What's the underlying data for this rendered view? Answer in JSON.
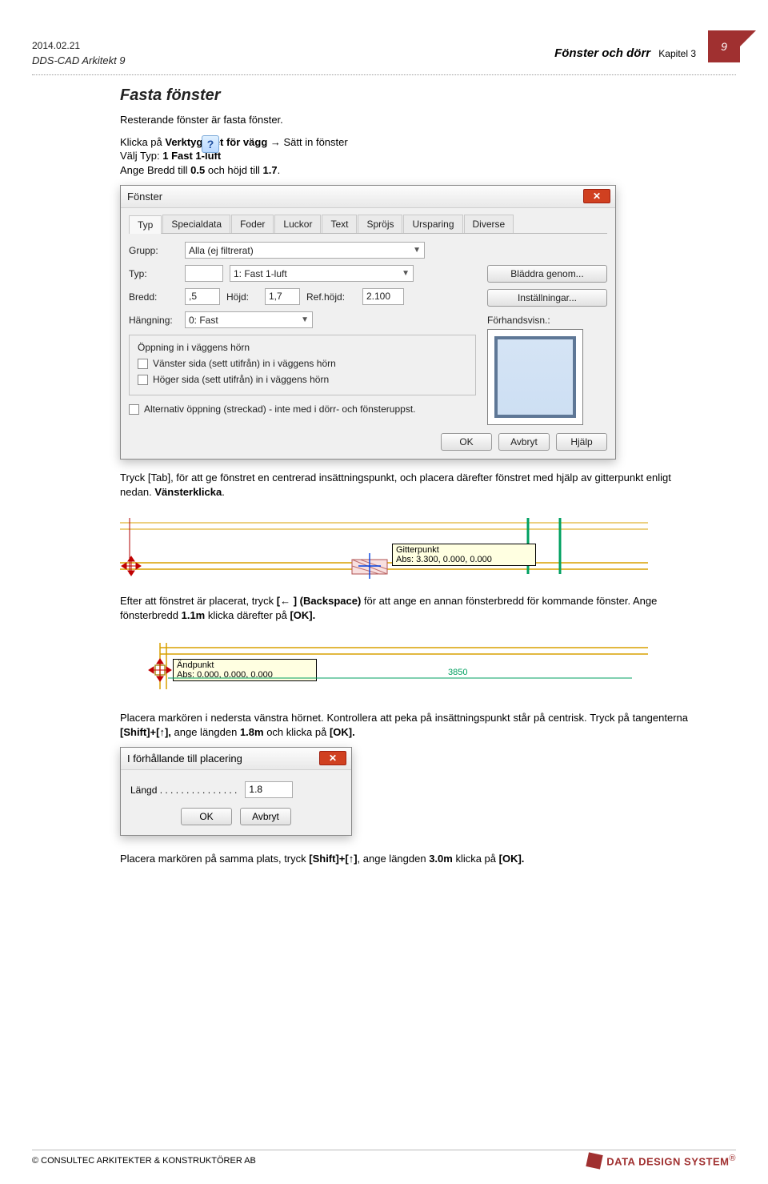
{
  "header": {
    "date": "2014.02.21",
    "software": "DDS-CAD Arkitekt 9",
    "doc_title": "Fönster och dörr",
    "chapter": "Kapitel 3",
    "page_number": "9"
  },
  "heading": "Fasta fönster",
  "text": {
    "intro": "Resterande fönster är fasta fönster.",
    "p2_a": "Klicka på ",
    "p2_b": "Verktygsset för vägg",
    "p2_c": " → Sätt in fönster",
    "p3_a": "Välj Typ: ",
    "p3_b": "1 Fast 1-luft",
    "p4_a": "Ange Bredd till ",
    "p4_b": "0.5",
    "p4_c": " och höjd till ",
    "p4_d": "1.7",
    "p4_e": ".",
    "p5_a": "Tryck [Tab], för att ge fönstret en centrerad insättningspunkt, och placera därefter fönstret med hjälp av gitterpunkt enligt nedan. ",
    "p5_b": "Vänsterklicka",
    "p5_c": ".",
    "p6_a": "Efter att fönstret är placerat, tryck ",
    "p6_b": "[← ] (Backspace)",
    "p6_c": " för att ange en annan fönsterbredd för kommande fönster. Ange fönsterbredd ",
    "p6_d": "1.1m",
    "p6_e": " klicka därefter på ",
    "p6_f": "[OK].",
    "p7_a": "Placera markören i nedersta vänstra hörnet. Kontrollera att peka på insättningspunkt står på centrisk. Tryck på tangenterna ",
    "p7_b": "[Shift]+[↑],",
    "p7_c": " ange längden ",
    "p7_d": "1.8m",
    "p7_e": " och klicka på ",
    "p7_f": "[OK].",
    "p8_a": "Placera markören på samma plats, tryck ",
    "p8_b": "[Shift]+[↑]",
    "p8_c": ", ange längden ",
    "p8_d": "3.0m",
    "p8_e": " klicka på ",
    "p8_f": "[OK]."
  },
  "dialog1": {
    "title": "Fönster",
    "tabs": [
      "Typ",
      "Specialdata",
      "Foder",
      "Luckor",
      "Text",
      "Spröjs",
      "Ursparing",
      "Diverse"
    ],
    "lbl_grupp": "Grupp:",
    "grupp_value": "Alla (ej filtrerat)",
    "lbl_typ": "Typ:",
    "typ_value": "1: Fast 1-luft",
    "btn_bladdra": "Bläddra genom...",
    "lbl_bredd": "Bredd:",
    "bredd_value": ",5",
    "lbl_hojd": "Höjd:",
    "hojd_value": "1,7",
    "lbl_refhojd": "Ref.höjd:",
    "refhojd_value": "2.100",
    "btn_installningar": "Inställningar...",
    "lbl_hangning": "Hängning:",
    "hangning_value": "0: Fast",
    "lbl_forhand": "Förhandsvisn.:",
    "group_label": "Öppning in i väggens hörn",
    "chk1": "Vänster sida (sett utifrån) in i väggens hörn",
    "chk2": "Höger sida (sett utifrån) in i väggens hörn",
    "chk3": "Alternativ öppning (streckad) - inte med i dörr- och fönsteruppst.",
    "btn_ok": "OK",
    "btn_avbryt": "Avbryt",
    "btn_hjalp": "Hjälp"
  },
  "drawing1": {
    "tooltip_title": "Gitterpunkt",
    "tooltip_coords": "Abs: 3.300, 0.000, 0.000"
  },
  "drawing2": {
    "tooltip_title": "Ändpunkt",
    "tooltip_coords": "Abs: 0.000, 0.000, 0.000",
    "dim": "3850"
  },
  "dialog2": {
    "title": "I förhållande till  placering",
    "lbl_langd": "Längd . . . . . . . . . . . . . . .",
    "langd_value": "1.8",
    "btn_ok": "OK",
    "btn_avbryt": "Avbryt"
  },
  "footer": {
    "left": "© CONSULTEC ARKITEKTER & KONSTRUKTÖRER AB",
    "brand_a": "DATA ",
    "brand_b": "DESIGN ",
    "brand_c": "SYSTEM"
  }
}
